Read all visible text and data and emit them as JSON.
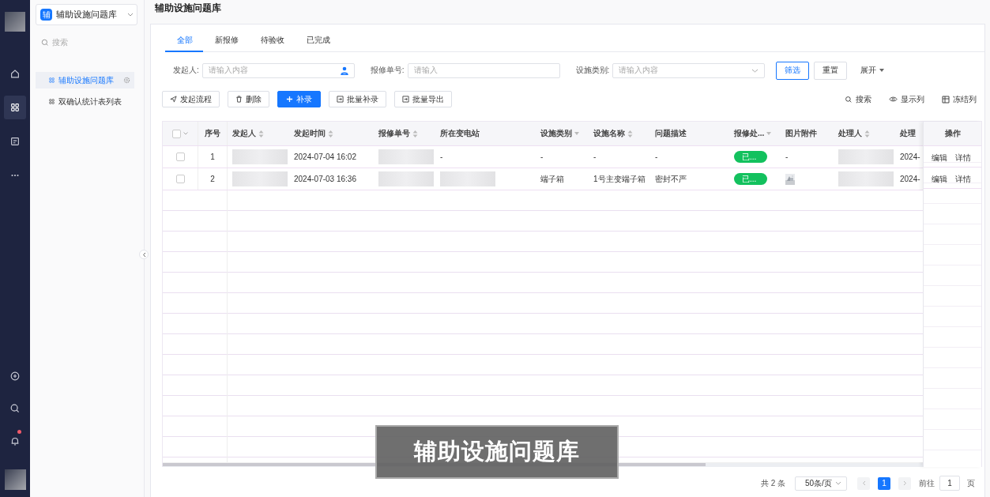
{
  "rail": {
    "nav_icons": [
      {
        "kind": "home",
        "selected": false
      },
      {
        "kind": "grid",
        "selected": true
      },
      {
        "kind": "form",
        "selected": false
      },
      {
        "kind": "more",
        "selected": false
      }
    ],
    "bottom_icons": [
      {
        "kind": "add"
      },
      {
        "kind": "search"
      },
      {
        "kind": "bell",
        "badge": true
      }
    ]
  },
  "app_switcher": {
    "badge": "辅",
    "title": "辅助设施问题库"
  },
  "sidebar": {
    "search_placeholder": "搜索",
    "items": [
      {
        "label": "辅助设施问题库",
        "selected": true
      },
      {
        "label": "双确认统计表列表",
        "selected": false
      }
    ]
  },
  "page_title": "辅助设施问题库",
  "tabs": [
    {
      "label": "全部",
      "selected": true
    },
    {
      "label": "新报修",
      "selected": false
    },
    {
      "label": "待验收",
      "selected": false
    },
    {
      "label": "已完成",
      "selected": false
    }
  ],
  "filters": [
    {
      "label": "发起人:",
      "placeholder": "请输入内容",
      "kind": "person"
    },
    {
      "label": "报修单号:",
      "placeholder": "请输入",
      "kind": "text"
    },
    {
      "label": "设施类别:",
      "placeholder": "请输入内容",
      "kind": "select"
    }
  ],
  "filter_buttons": [
    {
      "label": "筛选",
      "kind": "outline"
    },
    {
      "label": "重置",
      "kind": "plain"
    },
    {
      "label": "展开",
      "kind": "dropdown"
    }
  ],
  "actions": [
    {
      "label": "发起流程",
      "kind": "send"
    },
    {
      "label": "删除",
      "kind": "delete"
    },
    {
      "label": "补录",
      "kind": "add"
    },
    {
      "label": "批量补录",
      "kind": "import"
    },
    {
      "label": "批量导出",
      "kind": "import"
    }
  ],
  "tools": [
    {
      "label": "搜索",
      "kind": "search"
    },
    {
      "label": "显示列",
      "kind": "eye"
    },
    {
      "label": "冻结列",
      "kind": "freeze"
    }
  ],
  "table": {
    "select_all": {
      "checked": false
    },
    "columns": [
      {
        "label": "序号",
        "kind": "none"
      },
      {
        "label": "发起人",
        "kind": "sort"
      },
      {
        "label": "发起时间",
        "kind": "sort"
      },
      {
        "label": "报修单号",
        "kind": "sort"
      },
      {
        "label": "所在变电站",
        "kind": "none"
      },
      {
        "label": "设施类别",
        "kind": "filter"
      },
      {
        "label": "设施名称",
        "kind": "sort"
      },
      {
        "label": "问题描述",
        "kind": "none"
      },
      {
        "label": "报修处...",
        "kind": "filter"
      },
      {
        "label": "图片附件",
        "kind": "none"
      },
      {
        "label": "处理人",
        "kind": "sort"
      },
      {
        "label": "处理",
        "kind": "none"
      }
    ],
    "fixed_column": "操作",
    "rows": [
      {
        "checked": false,
        "cells": [
          {
            "kind": "text",
            "text": "1"
          },
          {
            "kind": "redacted"
          },
          {
            "kind": "text",
            "text": "2024-07-04 16:02"
          },
          {
            "kind": "redacted"
          },
          {
            "kind": "text",
            "text": "-"
          },
          {
            "kind": "text",
            "text": "-"
          },
          {
            "kind": "text",
            "text": "-"
          },
          {
            "kind": "text",
            "text": "-"
          },
          {
            "kind": "tag",
            "text": "已...",
            "color": "#13c15e"
          },
          {
            "kind": "text",
            "text": "-"
          },
          {
            "kind": "redacted"
          },
          {
            "kind": "text",
            "text": "2024-"
          }
        ],
        "actions": [
          "编辑",
          "详情"
        ]
      },
      {
        "checked": false,
        "cells": [
          {
            "kind": "text",
            "text": "2"
          },
          {
            "kind": "redacted"
          },
          {
            "kind": "text",
            "text": "2024-07-03 16:36"
          },
          {
            "kind": "redacted"
          },
          {
            "kind": "redacted"
          },
          {
            "kind": "text",
            "text": "端子箱"
          },
          {
            "kind": "text",
            "text": "1号主变端子箱"
          },
          {
            "kind": "text",
            "text": "密封不严"
          },
          {
            "kind": "tag",
            "text": "已...",
            "color": "#13c15e"
          },
          {
            "kind": "picture"
          },
          {
            "kind": "redacted"
          },
          {
            "kind": "text",
            "text": "2024-"
          }
        ],
        "actions": [
          "编辑",
          "详情"
        ]
      }
    ]
  },
  "pagination": {
    "total": "共 2 条",
    "page_size": "50条/页",
    "pages": [
      {
        "label": "1",
        "selected": true
      }
    ],
    "goto_label": "前往",
    "goto_value": "1",
    "goto_suffix": "页"
  },
  "caption": "辅助设施问题库"
}
